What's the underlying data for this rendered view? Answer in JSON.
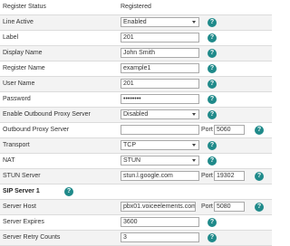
{
  "help_glyph": "?",
  "rows": {
    "register_status": {
      "label": "Register Status",
      "value": "Registered"
    },
    "line_active": {
      "label": "Line Active",
      "value": "Enabled"
    },
    "label": {
      "label": "Label",
      "value": "201"
    },
    "display_name": {
      "label": "Display Name",
      "value": "John Smith"
    },
    "register_name": {
      "label": "Register Name",
      "value": "example1"
    },
    "user_name": {
      "label": "User Name",
      "value": "201"
    },
    "password": {
      "label": "Password",
      "value": "••••••••"
    },
    "enable_outbound_proxy": {
      "label": "Enable Outbound Proxy Server",
      "value": "Disabled"
    },
    "outbound_proxy_server": {
      "label": "Outbound Proxy Server",
      "value": "",
      "port_label": "Port",
      "port": "5060"
    },
    "transport": {
      "label": "Transport",
      "value": "TCP"
    },
    "nat": {
      "label": "NAT",
      "value": "STUN"
    },
    "stun_server": {
      "label": "STUN Server",
      "value": "stun.l.google.com",
      "port_label": "Port",
      "port": "19302"
    },
    "sip_server_1": {
      "label": "SIP Server 1"
    },
    "server_host": {
      "label": "Server Host",
      "value": "pbx01.voiceelements.com",
      "port_label": "Port",
      "port": "5080"
    },
    "server_expires": {
      "label": "Server Expires",
      "value": "3600"
    },
    "server_retry_counts": {
      "label": "Server Retry Counts",
      "value": "3"
    }
  },
  "colors": {
    "help_icon": "#1f8a8a",
    "row_alt": "#f3f3f3",
    "border": "#dcdcdc"
  }
}
